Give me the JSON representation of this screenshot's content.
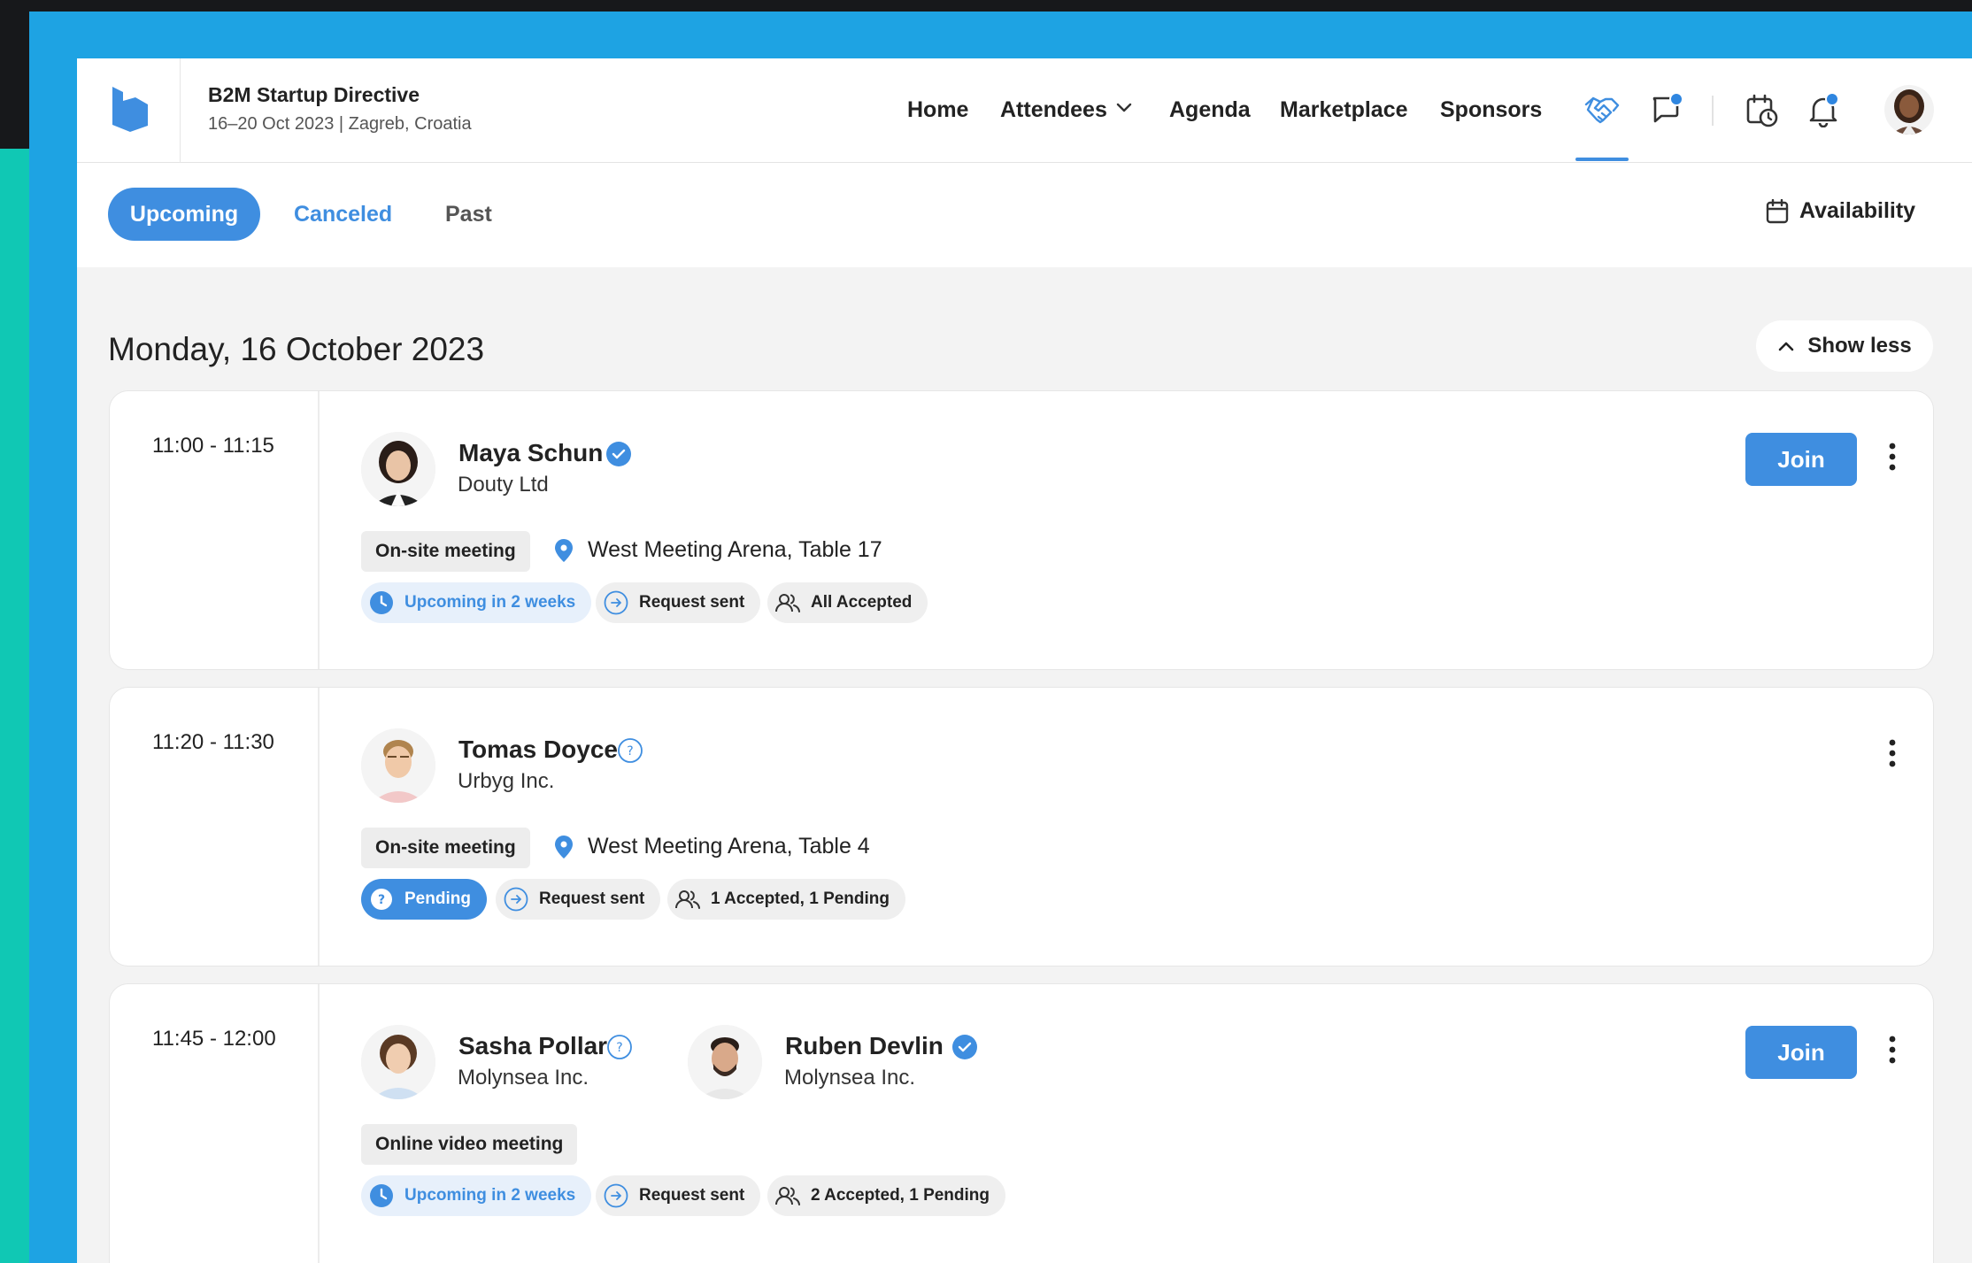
{
  "event": {
    "title": "B2M Startup Directive",
    "subtitle": "16–20 Oct 2023 | Zagreb, Croatia"
  },
  "nav": {
    "home": "Home",
    "attendees": "Attendees",
    "agenda": "Agenda",
    "marketplace": "Marketplace",
    "sponsors": "Sponsors"
  },
  "tabs": {
    "upcoming": "Upcoming",
    "canceled": "Canceled",
    "past": "Past",
    "availability": "Availability"
  },
  "colors": {
    "accent": "#3f8ee0",
    "frame": "#1ea3e3",
    "teal": "#10c8b4"
  },
  "day": {
    "heading": "Monday, 16 October 2023",
    "show_less": "Show less"
  },
  "meetings": [
    {
      "time": "11:00 - 11:15",
      "people": [
        {
          "name": "Maya Schun",
          "company": "Douty Ltd",
          "status": "verified"
        }
      ],
      "type": "On-site meeting",
      "location": "West Meeting Arena, Table 17",
      "chips": [
        "Upcoming in 2 weeks",
        "Request sent",
        "All Accepted"
      ],
      "join": "Join"
    },
    {
      "time": "11:20 - 11:30",
      "people": [
        {
          "name": "Tomas Doyce",
          "company": "Urbyg Inc.",
          "status": "pending"
        }
      ],
      "type": "On-site meeting",
      "location": "West Meeting Arena, Table 4",
      "chips": [
        "Pending",
        "Request sent",
        "1 Accepted, 1 Pending"
      ]
    },
    {
      "time": "11:45 - 12:00",
      "people": [
        {
          "name": "Sasha Pollar",
          "company": "Molynsea Inc.",
          "status": "pending"
        },
        {
          "name": "Ruben Devlin",
          "company": "Molynsea Inc.",
          "status": "verified"
        }
      ],
      "type": "Online video meeting",
      "chips": [
        "Upcoming in 2 weeks",
        "Request sent",
        "2 Accepted, 1 Pending"
      ],
      "join": "Join"
    }
  ]
}
